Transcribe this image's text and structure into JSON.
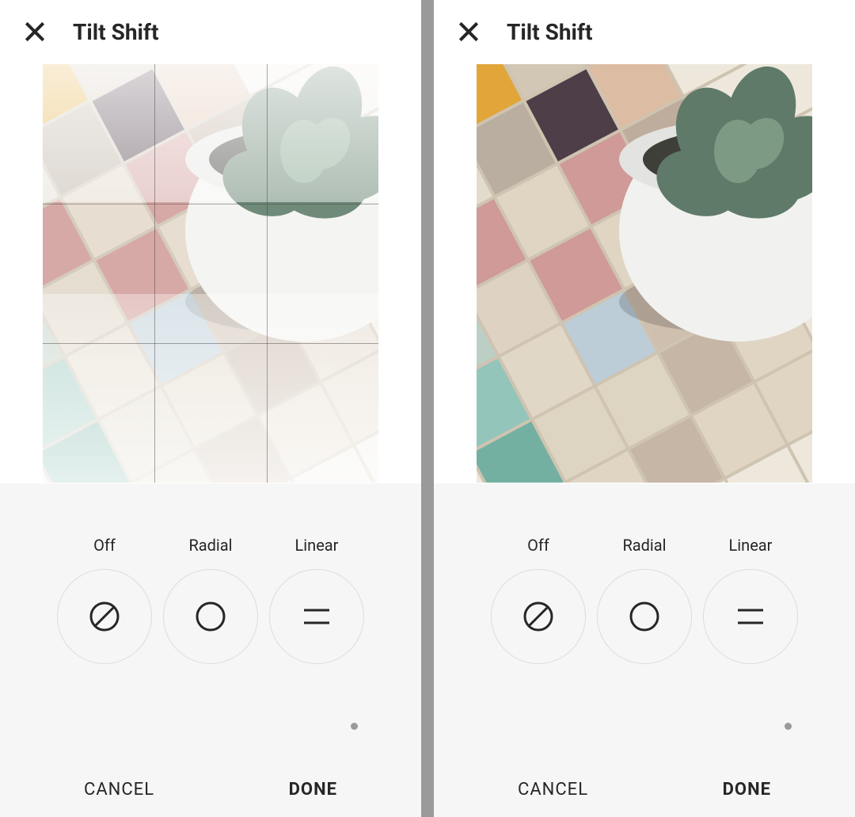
{
  "left": {
    "header": {
      "title": "Tilt Shift"
    },
    "grid_overlay_visible": true,
    "mask_overlay_visible": true,
    "controls": {
      "options": [
        {
          "label": "Off",
          "icon": "off-icon",
          "selected": false
        },
        {
          "label": "Radial",
          "icon": "radial-icon",
          "selected": false
        },
        {
          "label": "Linear",
          "icon": "linear-icon",
          "selected": false
        }
      ]
    },
    "footer": {
      "cancel": "CANCEL",
      "done": "DONE"
    }
  },
  "right": {
    "header": {
      "title": "Tilt Shift"
    },
    "grid_overlay_visible": false,
    "mask_overlay_visible": false,
    "controls": {
      "options": [
        {
          "label": "Off",
          "icon": "off-icon",
          "selected": false
        },
        {
          "label": "Radial",
          "icon": "radial-icon",
          "selected": false
        },
        {
          "label": "Linear",
          "icon": "linear-icon",
          "selected": false
        }
      ]
    },
    "footer": {
      "cancel": "CANCEL",
      "done": "DONE"
    }
  }
}
